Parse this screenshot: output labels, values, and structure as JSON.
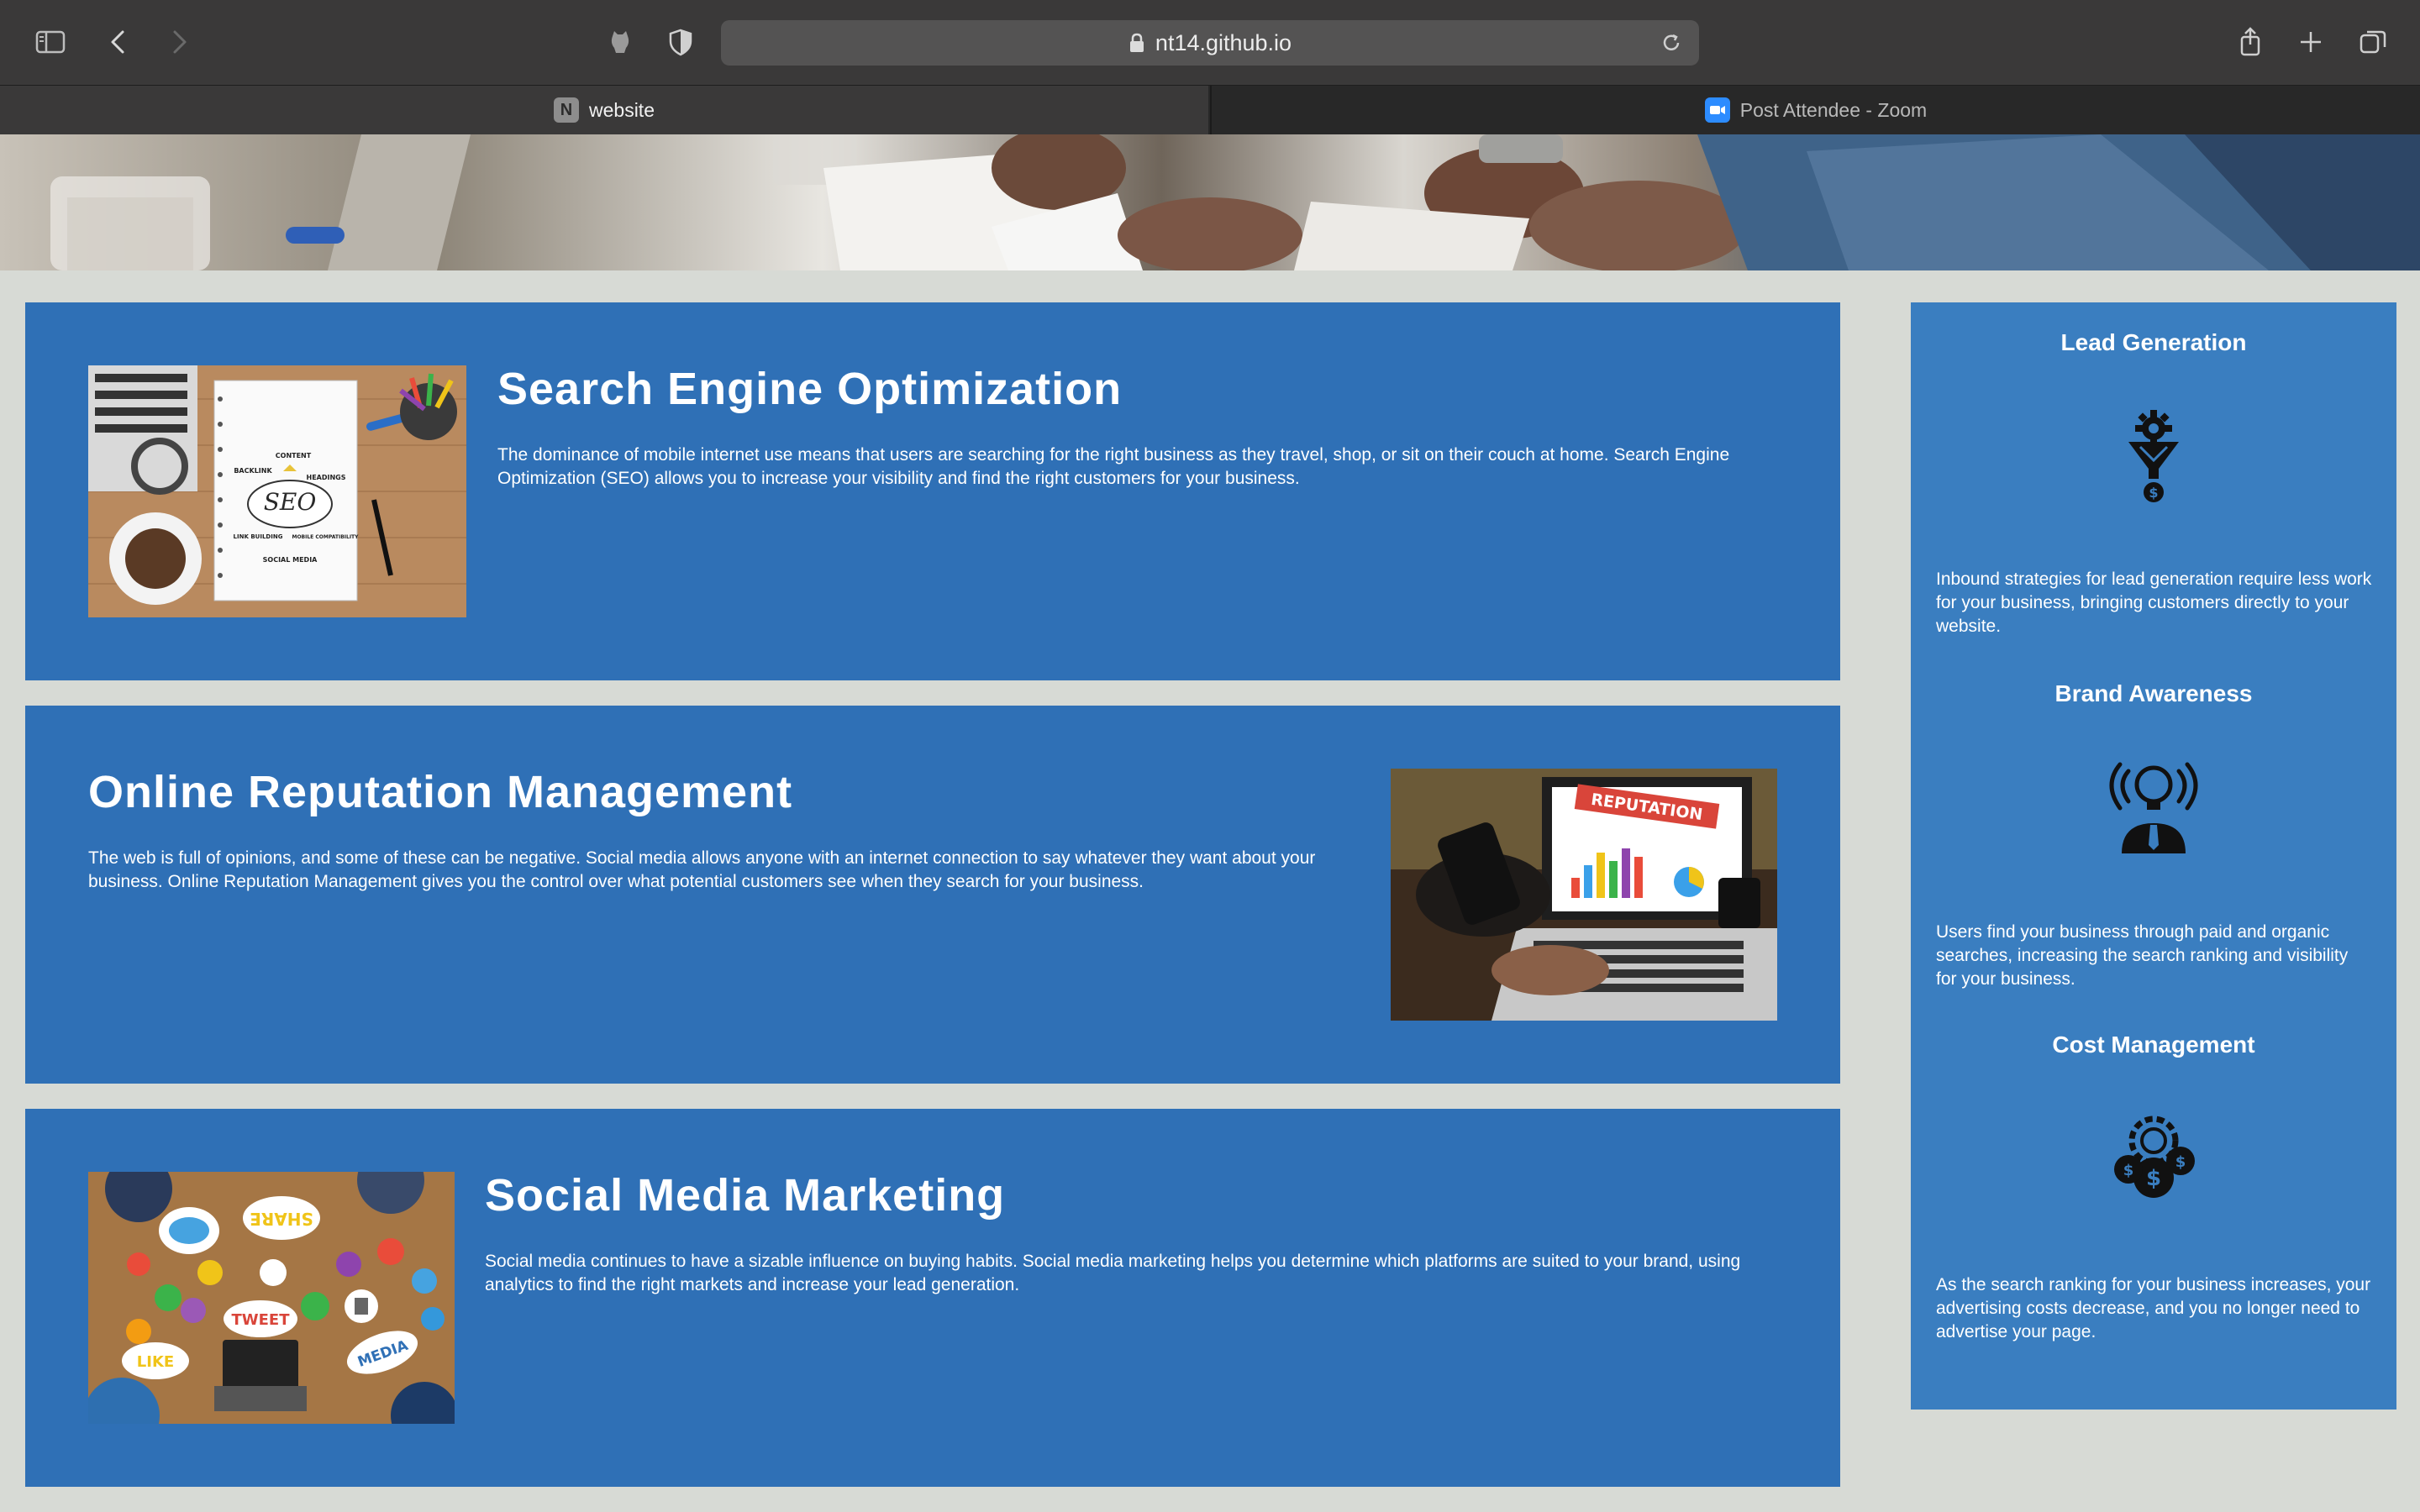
{
  "browser": {
    "url": "nt14.github.io",
    "tabs": [
      {
        "label": "website",
        "favicon": "N"
      },
      {
        "label": "Post Attendee - Zoom"
      }
    ]
  },
  "services": [
    {
      "title": "Search Engine Optimization",
      "body": "The dominance of mobile internet use means that users are searching for the right business as they travel, shop, or sit on their couch at home. Search Engine Optimization (SEO) allows you to increase your visibility and find the right customers for your business.",
      "image": "seo-notebook-image",
      "image_words": [
        "SEO",
        "CONTENT",
        "BACKLINK",
        "HEADINGS",
        "LINK BUILDING",
        "MOBILE COMPATIBILITY",
        "SOCIAL MEDIA"
      ]
    },
    {
      "title": "Online Reputation Management",
      "body": "The web is full of opinions, and some of these can be negative. Social media allows anyone with an internet connection to say whatever they want about your business. Online Reputation Management gives you the control over what potential customers see when they search for your business.",
      "image": "reputation-laptop-image",
      "image_words": [
        "REPUTATION"
      ]
    },
    {
      "title": "Social Media Marketing",
      "body": "Social media continues to have a sizable influence on buying habits. Social media marketing helps you determine which platforms are suited to your brand, using analytics to find the right markets and increase your lead generation.",
      "image": "social-media-table-image",
      "image_words": [
        "SHARE",
        "TWEET",
        "LIKE",
        "MEDIA"
      ]
    }
  ],
  "benefits": [
    {
      "title": "Lead Generation",
      "icon": "lead-generation-icon",
      "body": "Inbound strategies for lead generation require less work for your business, bringing customers directly to your website."
    },
    {
      "title": "Brand Awareness",
      "icon": "brand-awareness-icon",
      "body": "Users find your business through paid and organic searches, increasing the search ranking and visibility for your business."
    },
    {
      "title": "Cost Management",
      "icon": "cost-management-icon",
      "body": "As the search ranking for your business increases, your advertising costs decrease, and you no longer need to advertise your page."
    }
  ],
  "colors": {
    "page_background": "#d7dad5",
    "card_blue": "#2f70b6",
    "sidebar_blue": "#3a7ec0",
    "chrome_dark": "#3a3939"
  }
}
